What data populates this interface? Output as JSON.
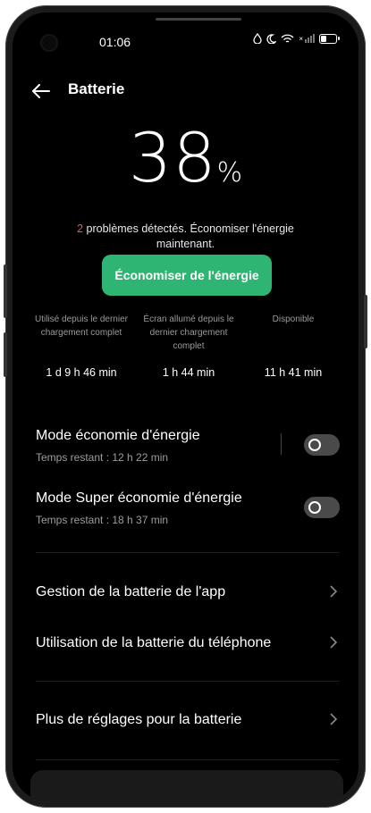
{
  "status_bar": {
    "time": "01:06",
    "signal_x": "×"
  },
  "header": {
    "title": "Batterie"
  },
  "battery": {
    "level": "38",
    "unit": "%"
  },
  "alert": {
    "count": "2",
    "text_after_count": " problèmes détectés. Économiser l'énergie maintenant."
  },
  "save_button_label": "Économiser de l'énergie",
  "stats": [
    {
      "label": "Utilisé depuis le dernier chargement complet",
      "value": "1 d 9 h 46 min"
    },
    {
      "label": "Écran allumé depuis le dernier chargement complet",
      "value": "1 h 44 min"
    },
    {
      "label": "Disponible",
      "value": "11 h 41 min"
    }
  ],
  "modes": [
    {
      "title": "Mode économie d'énergie",
      "subtitle": "Temps restant :  12 h 22 min",
      "enabled": false
    },
    {
      "title": "Mode Super économie d'énergie",
      "subtitle": "Temps restant :  18 h 37 min",
      "enabled": false
    }
  ],
  "links": [
    {
      "label": "Gestion de la batterie de l'app"
    },
    {
      "label": "Utilisation de la batterie du téléphone"
    },
    {
      "label": "Plus de réglages pour la batterie"
    }
  ]
}
